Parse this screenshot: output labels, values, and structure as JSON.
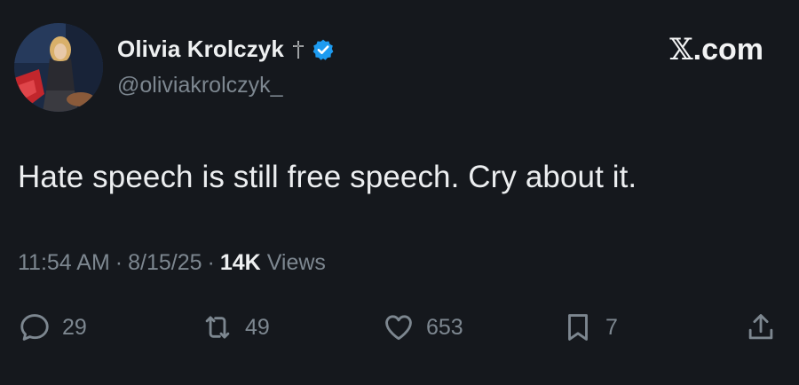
{
  "author": {
    "display_name": "Olivia Krolczyk",
    "handle": "@oliviakrolczyk_",
    "badge_icons": [
      "cross-icon",
      "verified-icon"
    ],
    "verified_color": "#1d9bf0"
  },
  "brand": {
    "x_glyph": "𝕏",
    "suffix": ".com"
  },
  "tweet": {
    "text": "Hate speech is still free speech. Cry about it."
  },
  "meta": {
    "time": "11:54 AM",
    "separator": "·",
    "date": "8/15/25",
    "views_count": "14K",
    "views_label": "Views"
  },
  "actions": {
    "reply": {
      "icon": "reply-icon",
      "count": "29"
    },
    "retweet": {
      "icon": "retweet-icon",
      "count": "49"
    },
    "like": {
      "icon": "heart-icon",
      "count": "653"
    },
    "bookmark": {
      "icon": "bookmark-icon",
      "count": "7"
    },
    "share": {
      "icon": "share-icon"
    }
  },
  "colors": {
    "background": "#15181d",
    "primary_text": "#eef0f1",
    "secondary_text": "#7d8790"
  }
}
